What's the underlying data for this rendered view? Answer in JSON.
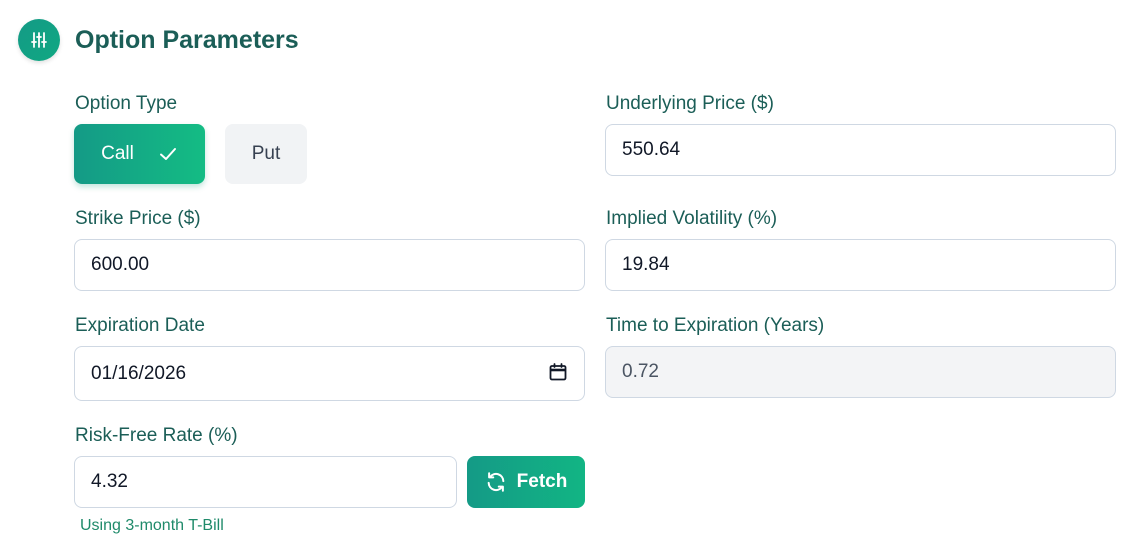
{
  "section": {
    "title": "Option Parameters",
    "icon": "sliders-icon"
  },
  "option_type": {
    "label": "Option Type",
    "call_label": "Call",
    "put_label": "Put",
    "selected": "Call"
  },
  "underlying_price": {
    "label": "Underlying Price ($)",
    "value": "550.64"
  },
  "strike_price": {
    "label": "Strike Price ($)",
    "value": "600.00"
  },
  "implied_volatility": {
    "label": "Implied Volatility (%)",
    "value": "19.84"
  },
  "expiration_date": {
    "label": "Expiration Date",
    "value": "01/16/2026"
  },
  "time_to_expiration": {
    "label": "Time to Expiration (Years)",
    "value": "0.72"
  },
  "risk_free_rate": {
    "label": "Risk-Free Rate (%)",
    "value": "4.32",
    "fetch_label": "Fetch",
    "hint": "Using 3-month T-Bill"
  },
  "colors": {
    "accent": "#14a085",
    "heading": "#1b5e57",
    "hint": "#1f8a6a"
  }
}
